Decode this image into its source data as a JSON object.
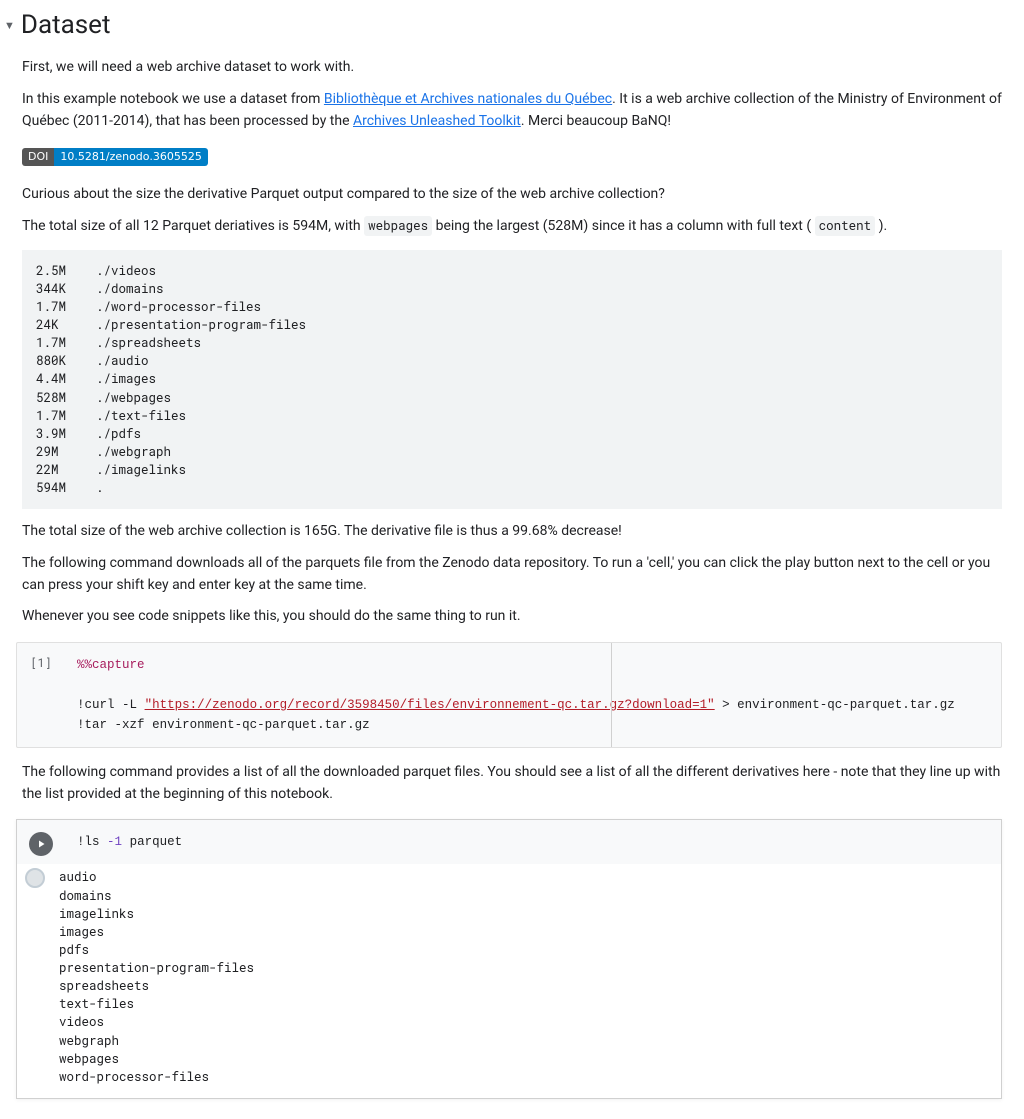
{
  "header": {
    "title": "Dataset"
  },
  "para": {
    "p1": "First, we will need a web archive dataset to work with.",
    "p2a": "In this example notebook we use a dataset from ",
    "p2_link1": "Bibliothèque et Archives nationales du Québec",
    "p2b": ". It is a web archive collection of the Ministry of Environment of Québec (2011-2014), that has been processed by the ",
    "p2_link2": "Archives Unleashed Toolkit",
    "p2c": ". Merci beaucoup BaNQ!",
    "p3": "Curious about the size the derivative Parquet output compared to the size of the web archive collection?",
    "p4a": "The total size of all 12 Parquet deriatives is 594M, with ",
    "p4_code1": "webpages",
    "p4b": " being the largest (528M) since it has a column with full text ( ",
    "p4_code2": "content",
    "p4c": " ).",
    "p5": "The total size of the web archive collection is 165G. The derivative file is thus a 99.68% decrease!",
    "p6": "The following command downloads all of the parquets file from the Zenodo data repository. To run a 'cell,' you can click the play button next to the cell or you can press your shift key and enter key at the same time.",
    "p7": "Whenever you see code snippets like this, you should do the same thing to run it.",
    "p8": "The following command provides a list of all the downloaded parquet files. You should see a list of all the different derivatives here - note that they line up with the list provided at the beginning of this notebook."
  },
  "doi": {
    "label": "DOI",
    "value": "10.5281/zenodo.3605525"
  },
  "filesize_listing": "2.5M    ./videos\n344K    ./domains\n1.7M    ./word-processor-files\n24K     ./presentation-program-files\n1.7M    ./spreadsheets\n880K    ./audio\n4.4M    ./images\n528M    ./webpages\n1.7M    ./text-files\n3.9M    ./pdfs\n29M     ./webgraph\n22M     ./imagelinks\n594M    .",
  "cells": {
    "c1": {
      "execution_count": "[1]",
      "magic": "%%capture",
      "curl": {
        "cmd": "curl",
        "flag": "-L",
        "url": "\"https://zenodo.org/record/3598450/files/environnement-qc.tar.gz?download=1\"",
        "redirect": " > environment-qc-parquet.tar.gz"
      },
      "tar": {
        "cmd": "tar",
        "flag": "-xzf",
        "arg": " environment-qc-parquet.tar.gz"
      }
    },
    "c2": {
      "ls": {
        "cmd": "ls",
        "flag": "-1",
        "arg": " parquet"
      },
      "output": "audio\ndomains\nimagelinks\nimages\npdfs\npresentation-program-files\nspreadsheets\ntext-files\nvideos\nwebgraph\nwebpages\nword-processor-files"
    }
  }
}
